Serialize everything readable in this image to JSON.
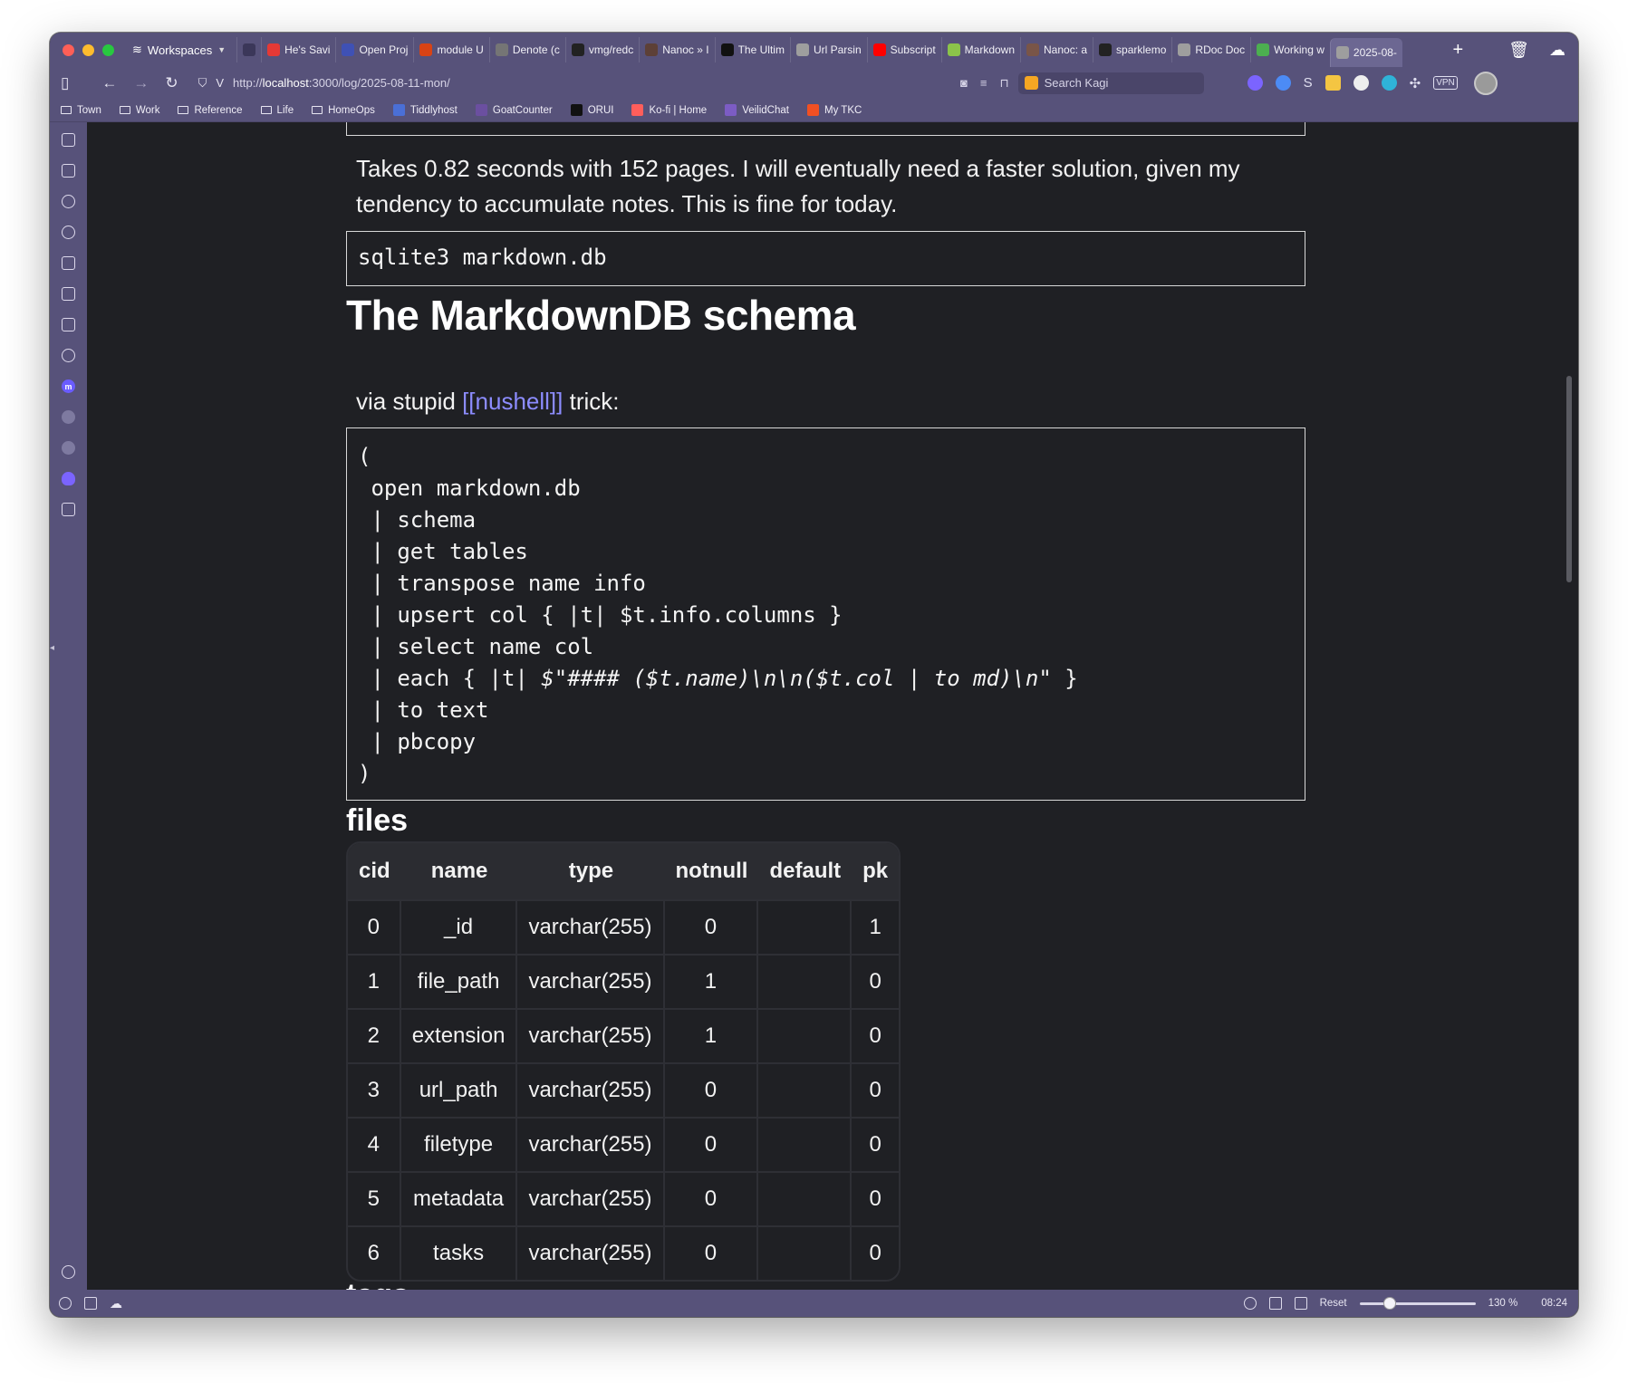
{
  "browser": {
    "workspaces_label": "Workspaces",
    "tabs": [
      {
        "label": "",
        "color": "#3b3759",
        "narrow": true,
        "icon": "perplexity-icon"
      },
      {
        "label": "He's Savi",
        "color": "#e53935",
        "icon": "quora-icon"
      },
      {
        "label": "Open Proj",
        "color": "#3f51b5",
        "icon": "openproject-icon"
      },
      {
        "label": "module U",
        "color": "#d84315",
        "icon": "ruby-icon"
      },
      {
        "label": "Denote (c",
        "color": "#757575",
        "icon": "denote-icon"
      },
      {
        "label": "vmg/redc",
        "color": "#222222",
        "icon": "github-icon"
      },
      {
        "label": "Nanoc » I",
        "color": "#5d4037",
        "icon": "nanoc-icon"
      },
      {
        "label": "The Ultim",
        "color": "#111111",
        "icon": "devto-icon"
      },
      {
        "label": "Url Parsin",
        "color": "#9e9e9e",
        "icon": "document-icon"
      },
      {
        "label": "Subscript",
        "color": "#ff0000",
        "icon": "youtube-icon"
      },
      {
        "label": "Markdown",
        "color": "#8bc34a",
        "icon": "markdown-icon"
      },
      {
        "label": "Nanoc: a",
        "color": "#795548",
        "icon": "nanoc-icon"
      },
      {
        "label": "sparklemo",
        "color": "#222222",
        "icon": "github-icon"
      },
      {
        "label": "RDoc Doc",
        "color": "#9e9e9e",
        "icon": "document-icon"
      },
      {
        "label": "Working w",
        "color": "#4caf50",
        "icon": "terminal-icon"
      },
      {
        "label": "2025-08-",
        "color": "#9e9e9e",
        "icon": "document-icon",
        "active": true
      }
    ],
    "url_prefix": "http://",
    "url_host": "localhost",
    "url_path": ":3000/log/2025-08-11-mon/",
    "search_placeholder": "Search Kagi",
    "bookmarks": [
      {
        "label": "Town",
        "type": "folder"
      },
      {
        "label": "Work",
        "type": "folder"
      },
      {
        "label": "Reference",
        "type": "folder"
      },
      {
        "label": "Life",
        "type": "folder"
      },
      {
        "label": "HomeOps",
        "type": "folder"
      },
      {
        "label": "Tiddlyhost",
        "type": "site",
        "color": "#4a6fd6"
      },
      {
        "label": "GoatCounter",
        "type": "site",
        "color": "#6b4fa0"
      },
      {
        "label": "ORUI",
        "type": "site",
        "color": "#111111"
      },
      {
        "label": "Ko-fi | Home",
        "type": "site",
        "color": "#ff5e5b"
      },
      {
        "label": "VeilidChat",
        "type": "site",
        "color": "#7c5cc4"
      },
      {
        "label": "My TKC",
        "type": "site",
        "color": "#f25022"
      }
    ],
    "status": {
      "reset_label": "Reset",
      "zoom": "130 %",
      "zoom_fraction": 0.26,
      "time": "08:24"
    }
  },
  "page": {
    "intro": "Takes 0.82 seconds with 152 pages. I will eventually need a faster solution, given my tendency to accumulate notes. This is fine for today.",
    "code_command": "sqlite3 markdown.db",
    "heading": "The MarkdownDB schema",
    "via_prefix": "via stupid ",
    "via_link": "[[nushell]]",
    "via_suffix": " trick:",
    "nushell_lines": [
      "(",
      " open markdown.db",
      " | schema",
      " | get tables",
      " | transpose name info",
      " | upsert col { |t| $t.info.columns }",
      " | select name col",
      " | each { |t| $\"#### ($t.name)\\n\\n($t.col | to md)\\n\" }",
      " | to text",
      " | pbcopy",
      ")"
    ],
    "files_heading": "files",
    "tags_heading": "tags",
    "table": {
      "headers": [
        "cid",
        "name",
        "type",
        "notnull",
        "default",
        "pk"
      ],
      "rows": [
        [
          "0",
          "_id",
          "varchar(255)",
          "0",
          "",
          "1"
        ],
        [
          "1",
          "file_path",
          "varchar(255)",
          "1",
          "",
          "0"
        ],
        [
          "2",
          "extension",
          "varchar(255)",
          "1",
          "",
          "0"
        ],
        [
          "3",
          "url_path",
          "varchar(255)",
          "0",
          "",
          "0"
        ],
        [
          "4",
          "filetype",
          "varchar(255)",
          "0",
          "",
          "0"
        ],
        [
          "5",
          "metadata",
          "varchar(255)",
          "0",
          "",
          "0"
        ],
        [
          "6",
          "tasks",
          "varchar(255)",
          "0",
          "",
          "0"
        ]
      ]
    }
  }
}
